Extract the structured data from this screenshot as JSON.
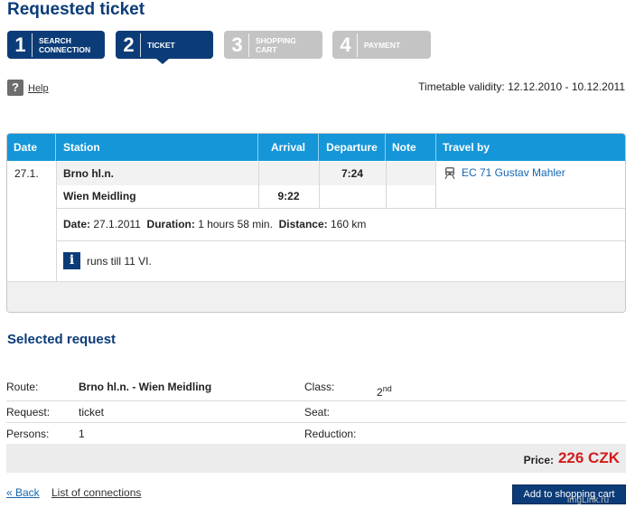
{
  "page": {
    "title": "Requested ticket"
  },
  "steps": [
    {
      "num": "1",
      "label": "SEARCH CONNECTION",
      "state": "active"
    },
    {
      "num": "2",
      "label": "TICKET",
      "state": "active"
    },
    {
      "num": "3",
      "label": "SHOPPING CART",
      "state": "inactive"
    },
    {
      "num": "4",
      "label": "PAYMENT",
      "state": "inactive"
    }
  ],
  "help": {
    "icon": "?",
    "label": "Help"
  },
  "validity": "Timetable validity: 12.12.2010 - 10.12.2011",
  "timetable": {
    "headers": {
      "date": "Date",
      "station": "Station",
      "arrival": "Arrival",
      "departure": "Departure",
      "note": "Note",
      "travel_by": "Travel by"
    },
    "date": "27.1.",
    "rows": [
      {
        "station": "Brno hl.n.",
        "arrival": "",
        "departure": "7:24"
      },
      {
        "station": "Wien Meidling",
        "arrival": "9:22",
        "departure": ""
      }
    ],
    "train": "EC 71 Gustav Mahler",
    "summary": {
      "date_label": "Date:",
      "date": "27.1.2011",
      "duration_label": "Duration:",
      "duration": "1 hours 58 min.",
      "distance_label": "Distance:",
      "distance": "160 km"
    },
    "note_text": "runs till 11 VI."
  },
  "selected": {
    "title": "Selected request",
    "route_label": "Route:",
    "route": "Brno hl.n. - Wien Meidling",
    "class_label": "Class:",
    "class_value": "2",
    "class_sup": "nd",
    "request_label": "Request:",
    "request": "ticket",
    "seat_label": "Seat:",
    "persons_label": "Persons:",
    "persons": "1",
    "reduction_label": "Reduction:",
    "price_label": "Price:",
    "price": "226 CZK"
  },
  "footer": {
    "back": "« Back",
    "list": "List of connections",
    "add_cart": "Add to shopping cart",
    "watermark": "imgLink.ru"
  },
  "colors": {
    "accent": "#0c3c78",
    "header_blue": "#1596d8",
    "price_red": "#d31b1b",
    "step_inactive": "#c4c4c4"
  }
}
